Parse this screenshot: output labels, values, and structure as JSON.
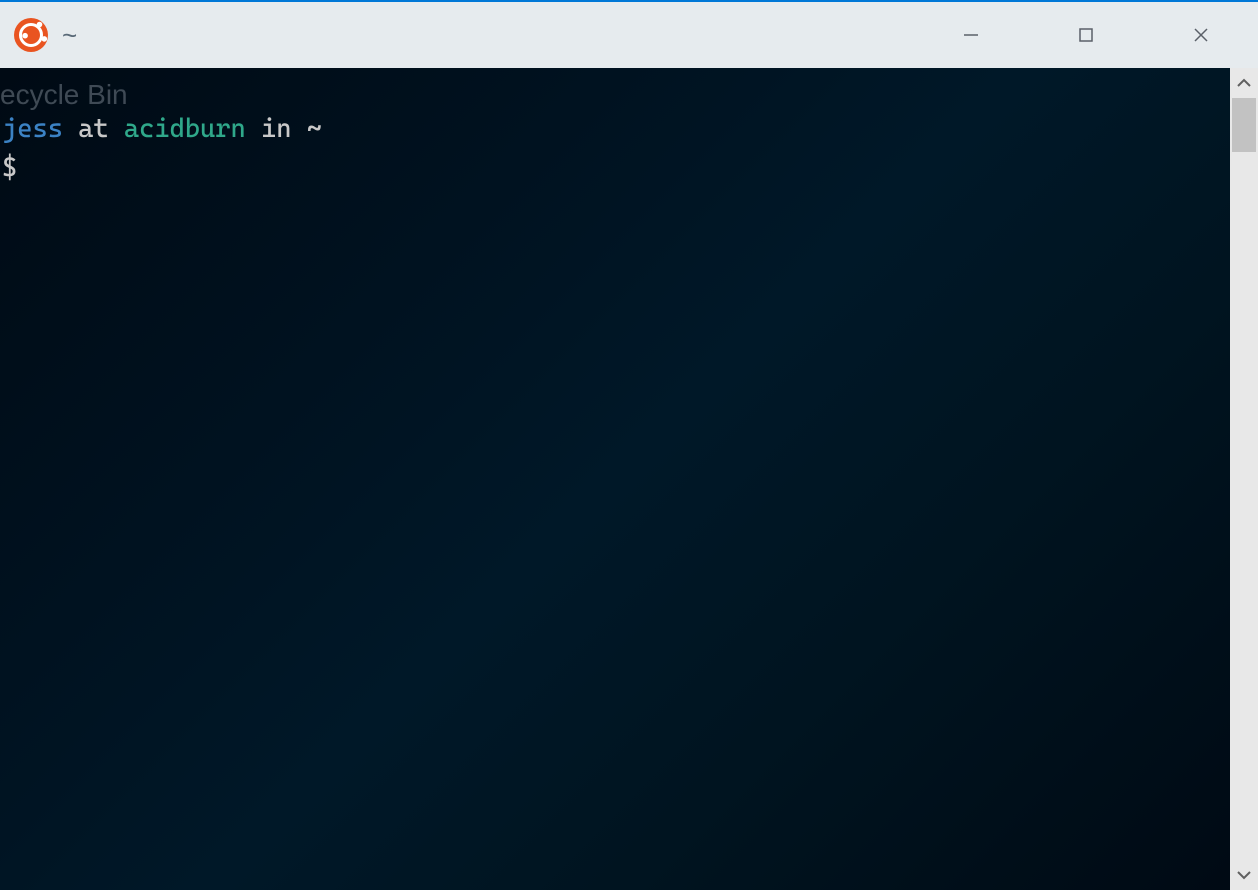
{
  "titlebar": {
    "app_icon": "ubuntu-icon",
    "title": "~"
  },
  "window_controls": {
    "minimize": "minimize-icon",
    "maximize": "maximize-icon",
    "close": "close-icon"
  },
  "terminal": {
    "background_desktop_label": "ecycle Bin",
    "prompt": {
      "user": "jess",
      "at": " at ",
      "host": "acidburn",
      "in": " in ",
      "path": "~",
      "symbol": "$"
    },
    "current_input": ""
  },
  "scrollbar": {
    "up": "chevron-up-icon",
    "down": "chevron-down-icon"
  },
  "colors": {
    "titlebar_bg": "#e6ebee",
    "terminal_bg": "#000a14",
    "user_fg": "#3b82c4",
    "host_fg": "#2fa88a",
    "text_fg": "#c8c8c8",
    "ubuntu_orange": "#e95420"
  }
}
